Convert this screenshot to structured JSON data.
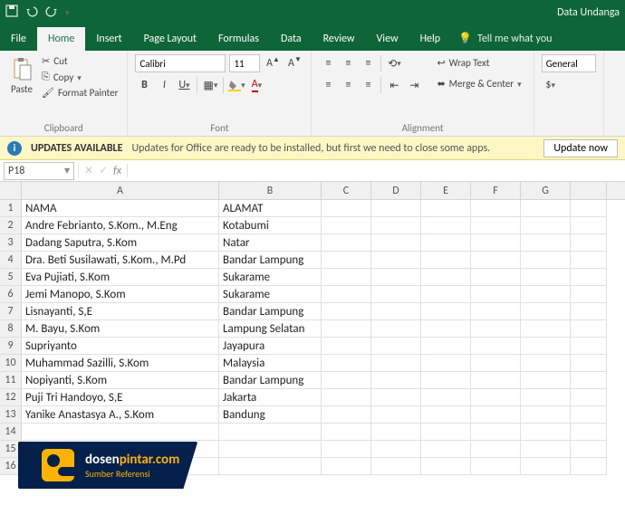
{
  "title": "Data Undanga",
  "tabs": [
    "File",
    "Home",
    "Insert",
    "Page Layout",
    "Formulas",
    "Data",
    "Review",
    "View",
    "Help"
  ],
  "tellme": "Tell me what you",
  "clipboard": {
    "paste": "Paste",
    "cut": "Cut",
    "copy": "Copy",
    "fmtpaint": "Format Painter",
    "label": "Clipboard"
  },
  "font": {
    "name": "Calibri",
    "size": "11",
    "label": "Font"
  },
  "align": {
    "wrap": "Wrap Text",
    "merge": "Merge & Center",
    "label": "Alignment"
  },
  "number": {
    "fmt": "General"
  },
  "msg": {
    "title": "UPDATES AVAILABLE",
    "body": "Updates for Office are ready to be installed, but first we need to close some apps.",
    "btn": "Update now"
  },
  "namebox": "P18",
  "cols": [
    "A",
    "B",
    "C",
    "D",
    "E",
    "F",
    "G"
  ],
  "rows": [
    {
      "n": 1,
      "a": "NAMA",
      "b": "ALAMAT"
    },
    {
      "n": 2,
      "a": "Andre Febrianto, S.Kom., M.Eng",
      "b": "Kotabumi"
    },
    {
      "n": 3,
      "a": "Dadang Saputra, S.Kom",
      "b": "Natar"
    },
    {
      "n": 4,
      "a": "Dra. Beti Susilawati, S.Kom., M.Pd",
      "b": "Bandar Lampung"
    },
    {
      "n": 5,
      "a": "Eva Pujiati, S.Kom",
      "b": "Sukarame"
    },
    {
      "n": 6,
      "a": "Jemi Manopo, S.Kom",
      "b": "Sukarame"
    },
    {
      "n": 7,
      "a": "Lisnayanti, S,E",
      "b": "Bandar Lampung"
    },
    {
      "n": 8,
      "a": "M. Bayu, S.Kom",
      "b": "Lampung Selatan"
    },
    {
      "n": 9,
      "a": "Supriyanto",
      "b": "Jayapura"
    },
    {
      "n": 10,
      "a": "Muhammad Sazilli, S.Kom",
      "b": "Malaysia"
    },
    {
      "n": 11,
      "a": "Nopiyanti, S.Kom",
      "b": "Bandar Lampung"
    },
    {
      "n": 12,
      "a": "Puji Tri Handoyo, S,E",
      "b": "Jakarta"
    },
    {
      "n": 13,
      "a": "Yanike Anastasya A., S.Kom",
      "b": "Bandung"
    },
    {
      "n": 14,
      "a": "",
      "b": ""
    },
    {
      "n": 15,
      "a": "",
      "b": ""
    },
    {
      "n": 16,
      "a": "",
      "b": ""
    }
  ],
  "wm": {
    "brand": "dosen",
    "brand2": "pintar.com",
    "sub": "Sumber Referensi"
  }
}
